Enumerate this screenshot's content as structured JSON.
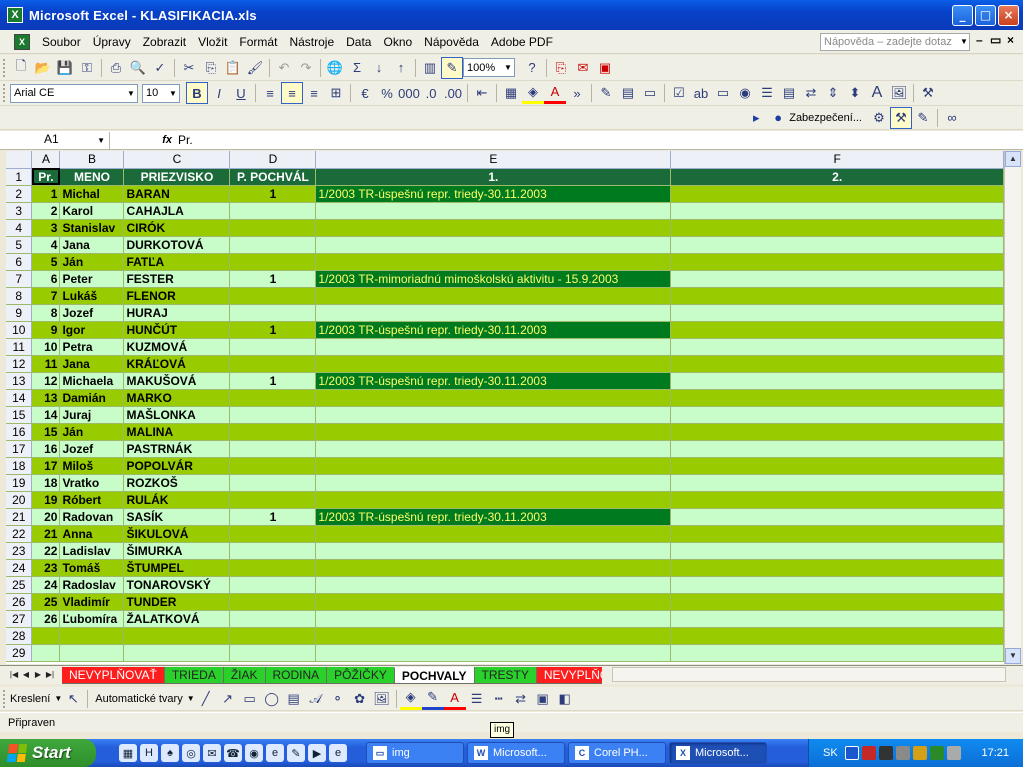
{
  "window": {
    "title": "Microsoft Excel - KLASIFIKACIA.xls"
  },
  "menu": {
    "items": [
      "Soubor",
      "Úpravy",
      "Zobrazit",
      "Vložit",
      "Formát",
      "Nástroje",
      "Data",
      "Okno",
      "Nápověda",
      "Adobe PDF"
    ],
    "help_placeholder": "Nápověda – zadejte dotaz"
  },
  "toolbar": {
    "zoom": "100%",
    "font": "Arial CE",
    "size": "10",
    "security": "Zabezpečení..."
  },
  "formula": {
    "cell": "A1",
    "fx": "fx",
    "content": "Pr."
  },
  "columns": [
    "A",
    "B",
    "C",
    "D",
    "E",
    "F"
  ],
  "header_row": {
    "num": "1",
    "a": "Pr.",
    "b": "MENO",
    "c": "PRIEZVISKO",
    "d": "P. POCHVÁL",
    "e": "1.",
    "f": "2."
  },
  "rows": [
    {
      "num": "2",
      "a": "1",
      "b": "Michal",
      "c": "BARAN",
      "d": "1",
      "e": "1/2003 TR-úspešnú repr. triedy-30.11.2003"
    },
    {
      "num": "3",
      "a": "2",
      "b": "Karol",
      "c": "CAHAJLA",
      "d": "",
      "e": ""
    },
    {
      "num": "4",
      "a": "3",
      "b": "Stanislav",
      "c": "CIRÓK",
      "d": "",
      "e": ""
    },
    {
      "num": "5",
      "a": "4",
      "b": "Jana",
      "c": "DURKOTOVÁ",
      "d": "",
      "e": ""
    },
    {
      "num": "6",
      "a": "5",
      "b": "Ján",
      "c": "FATĽA",
      "d": "",
      "e": ""
    },
    {
      "num": "7",
      "a": "6",
      "b": "Peter",
      "c": "FESTER",
      "d": "1",
      "e": "1/2003 TR-mimoriadnú mimoškolskú aktivitu - 15.9.2003"
    },
    {
      "num": "8",
      "a": "7",
      "b": "Lukáš",
      "c": "FLENOR",
      "d": "",
      "e": ""
    },
    {
      "num": "9",
      "a": "8",
      "b": "Jozef",
      "c": "HURAJ",
      "d": "",
      "e": ""
    },
    {
      "num": "10",
      "a": "9",
      "b": "Igor",
      "c": "HUNČÚT",
      "d": "1",
      "e": "1/2003 TR-úspešnú repr. triedy-30.11.2003"
    },
    {
      "num": "11",
      "a": "10",
      "b": "Petra",
      "c": "KUZMOVÁ",
      "d": "",
      "e": ""
    },
    {
      "num": "12",
      "a": "11",
      "b": "Jana",
      "c": "KRÁĽOVÁ",
      "d": "",
      "e": ""
    },
    {
      "num": "13",
      "a": "12",
      "b": "Michaela",
      "c": "MAKUŠOVÁ",
      "d": "1",
      "e": "1/2003 TR-úspešnú repr. triedy-30.11.2003"
    },
    {
      "num": "14",
      "a": "13",
      "b": "Damián",
      "c": "MARKO",
      "d": "",
      "e": ""
    },
    {
      "num": "15",
      "a": "14",
      "b": "Juraj",
      "c": "MAŠLONKA",
      "d": "",
      "e": ""
    },
    {
      "num": "16",
      "a": "15",
      "b": "Ján",
      "c": "MALINA",
      "d": "",
      "e": ""
    },
    {
      "num": "17",
      "a": "16",
      "b": "Jozef",
      "c": "PASTRNÁK",
      "d": "",
      "e": ""
    },
    {
      "num": "18",
      "a": "17",
      "b": "Miloš",
      "c": "POPOLVÁR",
      "d": "",
      "e": ""
    },
    {
      "num": "19",
      "a": "18",
      "b": "Vratko",
      "c": "ROZKOŠ",
      "d": "",
      "e": ""
    },
    {
      "num": "20",
      "a": "19",
      "b": "Róbert",
      "c": "RULÁK",
      "d": "",
      "e": ""
    },
    {
      "num": "21",
      "a": "20",
      "b": "Radovan",
      "c": "SASÍK",
      "d": "1",
      "e": "1/2003 TR-úspešnú repr. triedy-30.11.2003"
    },
    {
      "num": "22",
      "a": "21",
      "b": "Anna",
      "c": "ŠIKULOVÁ",
      "d": "",
      "e": ""
    },
    {
      "num": "23",
      "a": "22",
      "b": "Ladislav",
      "c": "ŠIMURKA",
      "d": "",
      "e": ""
    },
    {
      "num": "24",
      "a": "23",
      "b": "Tomáš",
      "c": "ŠTUMPEL",
      "d": "",
      "e": ""
    },
    {
      "num": "25",
      "a": "24",
      "b": "Radoslav",
      "c": "TONAROVSKÝ",
      "d": "",
      "e": ""
    },
    {
      "num": "26",
      "a": "25",
      "b": "Vladimír",
      "c": "TUNDER",
      "d": "",
      "e": ""
    },
    {
      "num": "27",
      "a": "26",
      "b": "Ľubomíra",
      "c": "ŽALATKOVÁ",
      "d": "",
      "e": ""
    },
    {
      "num": "28",
      "a": "",
      "b": "",
      "c": "",
      "d": "",
      "e": ""
    },
    {
      "num": "29",
      "a": "",
      "b": "",
      "c": "",
      "d": "",
      "e": ""
    }
  ],
  "sheet_tabs": [
    {
      "label": "NEVYPLŇOVAŤ",
      "style": "red"
    },
    {
      "label": "TRIEDA",
      "style": "green"
    },
    {
      "label": "ŽIAK",
      "style": "green"
    },
    {
      "label": "RODINA",
      "style": "green"
    },
    {
      "label": "PÔŽIČKY",
      "style": "green"
    },
    {
      "label": "POCHVALY",
      "style": "active"
    },
    {
      "label": "TRESTY",
      "style": "green"
    },
    {
      "label": "NEVYPLŇOV",
      "style": "red"
    }
  ],
  "drawing": {
    "draw": "Kreslení",
    "autoshapes": "Automatické tvary"
  },
  "status": {
    "text": "Připraven",
    "tooltip": "img"
  },
  "taskbar": {
    "start": "Start",
    "tasks": [
      {
        "label": "img",
        "icon": "folder-icon",
        "active": false
      },
      {
        "label": "Microsoft...",
        "icon": "word-icon",
        "active": false
      },
      {
        "label": "Corel PH...",
        "icon": "corel-icon",
        "active": false
      },
      {
        "label": "Microsoft...",
        "icon": "excel-icon",
        "active": true
      }
    ],
    "lang": "SK",
    "clock": "17:21"
  },
  "colors": {
    "row_light": "#c8fcc8",
    "row_dark": "#99cc00",
    "header": "#1b6a3a",
    "note_bg": "#007a1f",
    "note_fg": "#ffff66"
  }
}
